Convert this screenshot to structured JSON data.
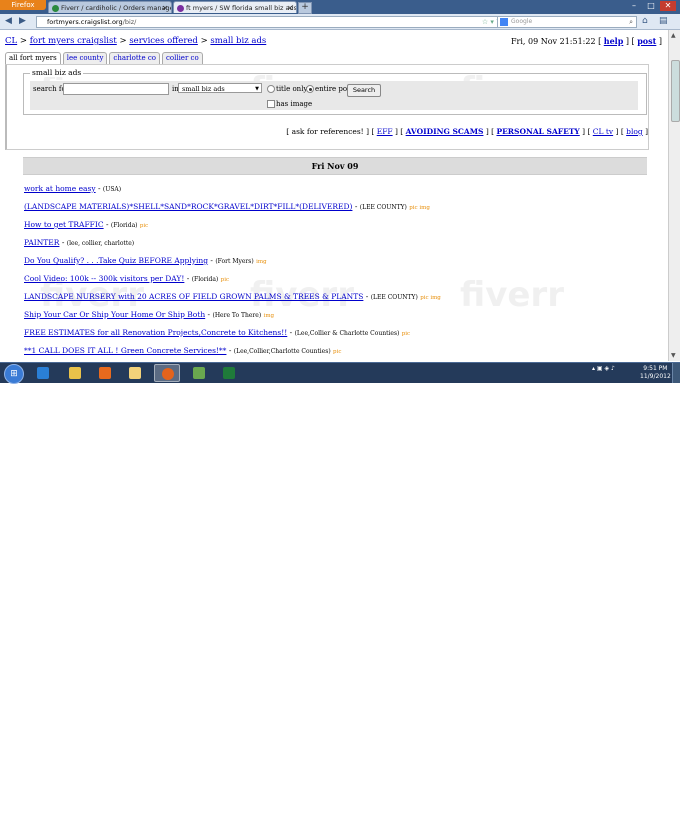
{
  "browser": {
    "app_button": "Firefox",
    "tabs": [
      {
        "title": "Fiverr / cardiholic / Orders managem...",
        "active": false
      },
      {
        "title": "ft myers / SW florida small biz ads cla...",
        "active": true
      }
    ],
    "new_tab": "+",
    "url_domain": "fortmyers.craigslist.org",
    "url_path": "/biz/",
    "search_placeholder": "Google"
  },
  "page": {
    "breadcrumb": {
      "cl": "CL",
      "city": "fort myers craigslist",
      "section": "services offered",
      "category": "small biz ads",
      "sep": ">"
    },
    "datetime": "Fri, 09 Nov 21:51:22",
    "help": "help",
    "post": "post",
    "area_tabs": [
      "all fort myers",
      "lee county",
      "charlotte co",
      "collier co"
    ],
    "search": {
      "legend": "small biz ads",
      "for_label": "search for:",
      "for_value": "",
      "in_label": "in:",
      "category": "small biz ads",
      "title_only": "title only",
      "entire_post": "entire post",
      "selected_scope": "entire post",
      "button": "Search",
      "has_image": "has image",
      "has_image_checked": false
    },
    "links": {
      "ask": "ask for references!",
      "eff": "EFF",
      "scams": "AVOIDING SCAMS",
      "safety": "PERSONAL SAFETY",
      "cltv": "CL tv",
      "blog": "blog"
    },
    "date_header": "Fri Nov 09",
    "posts": [
      {
        "title": "work at home easy",
        "location": "(USA)",
        "tag": ""
      },
      {
        "title": "(LANDSCAPE MATERIALS)*SHELL*SAND*ROCK*GRAVEL*DIRT*FILL*(DELIVERED)",
        "location": "(LEE COUNTY)",
        "tag": "pic img"
      },
      {
        "title": "How to get TRAFFIC",
        "location": "(Florida)",
        "tag": "pic"
      },
      {
        "title": "PAINTER",
        "location": "(lee, collier, charlotte)",
        "tag": ""
      },
      {
        "title": "Do You Qualify? . . .Take Quiz BEFORE Applying",
        "location": "(Fort Myers)",
        "tag": "img"
      },
      {
        "title": "Cool Video: 100k -- 300k visitors per DAY!",
        "location": "(Florida)",
        "tag": "pic"
      },
      {
        "title": "LANDSCAPE NURSERY with 20 ACRES OF FIELD GROWN PALMS & TREES & PLANTS",
        "location": "(LEE COUNTY)",
        "tag": "pic img"
      },
      {
        "title": "Ship Your Car Or Ship Your Home Or Ship Both",
        "location": "(Here To There)",
        "tag": "img"
      },
      {
        "title": "FREE ESTIMATES for all Renovation Projects,Concrete to Kitchens!!",
        "location": "(Lee,Collier & Charlotte Counties)",
        "tag": "pic"
      },
      {
        "title": "**1 CALL DOES IT ALL ! Green Concrete Services!**",
        "location": "(Lee,Collier,Charlotte Counties)",
        "tag": "pic"
      }
    ],
    "watermark": "fiverr"
  },
  "taskbar": {
    "clock_time": "9:51 PM",
    "clock_date": "11/9/2012",
    "pinned_icons": [
      "ie-icon",
      "explorer-icon",
      "media-player-icon",
      "folder-icon",
      "firefox-icon",
      "app-icon",
      "excel-icon"
    ],
    "active_icon": "firefox-icon"
  }
}
